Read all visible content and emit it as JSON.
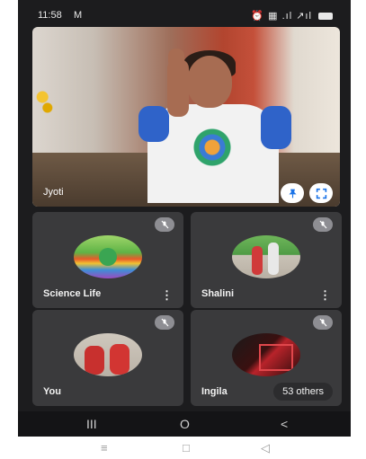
{
  "status_bar": {
    "time": "11:58",
    "notification_icon": "M",
    "right_icons": "⏰ ▦ .ıl ↗ıl"
  },
  "main_video": {
    "participant_name": "Jyoti",
    "pin_icon": "pin-icon",
    "fullscreen_icon": "fullscreen-icon"
  },
  "participants": [
    {
      "name": "Science Life",
      "muted": true,
      "has_menu": true
    },
    {
      "name": "Shalini",
      "muted": true,
      "has_menu": true
    },
    {
      "name": "You",
      "muted": true,
      "has_menu": false
    },
    {
      "name": "Ingila",
      "muted": true,
      "has_menu": false,
      "others_label": "53 others"
    }
  ],
  "nav": {
    "dark": {
      "recent": "III",
      "home": "O",
      "back": "<"
    },
    "light": {
      "recent": "≡",
      "home": "□",
      "back": "◁"
    }
  }
}
